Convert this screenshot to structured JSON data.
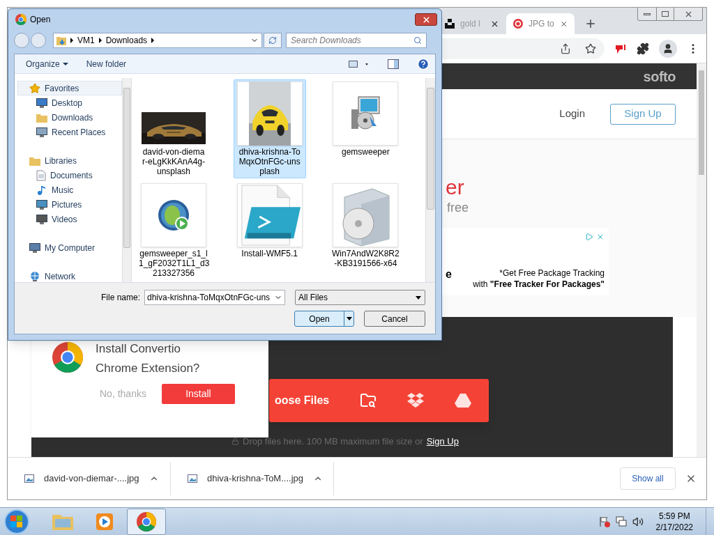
{
  "browser": {
    "tabs": [
      {
        "label": "gold l",
        "selected": false
      },
      {
        "label": "JPG to",
        "selected": true
      }
    ],
    "page": {
      "logo": "softo",
      "login": "Login",
      "signup": "Sign Up",
      "heading": "er",
      "subheading": "free",
      "ad": {
        "side_text": "e",
        "lines": [
          "*Get Free Package Tracking",
          "with **\"Free Tracker For Packages\"**"
        ]
      },
      "upload": {
        "button": "oose Files",
        "note": "Drop files here. 100 MB maximum file size or",
        "link": "Sign Up"
      },
      "popup": {
        "title_lines": [
          "Install Convertio",
          "Chrome Extension?"
        ],
        "dismiss": "No, thanks",
        "install": "Install"
      }
    },
    "downloads": {
      "items": [
        "david-von-diemar-....jpg",
        "dhiva-krishna-ToM....jpg"
      ],
      "show_all": "Show all"
    }
  },
  "dialog": {
    "title": "Open",
    "breadcrumb": [
      "VM1",
      "Downloads"
    ],
    "search": {
      "placeholder": "Search Downloads"
    },
    "toolbar": [
      "Organize",
      "New folder"
    ],
    "nav": [
      {
        "label": "Favorites",
        "kind": "star",
        "selected": true,
        "children": [
          {
            "label": "Desktop",
            "kind": "desktop",
            "selected": false
          },
          {
            "label": "Downloads",
            "kind": "folder",
            "selected": false
          },
          {
            "label": "Recent Places",
            "kind": "recent",
            "selected": false
          }
        ]
      },
      {
        "label": "Libraries",
        "kind": "library",
        "selected": false,
        "children": [
          {
            "label": "Documents",
            "kind": "document",
            "selected": false
          },
          {
            "label": "Music",
            "kind": "music",
            "selected": false
          },
          {
            "label": "Pictures",
            "kind": "picture",
            "selected": false
          },
          {
            "label": "Videos",
            "kind": "video",
            "selected": false
          }
        ]
      },
      {
        "label": "My Computer",
        "kind": "computer",
        "selected": false
      },
      {
        "label": "Network",
        "kind": "network",
        "selected": false
      }
    ],
    "files": [
      {
        "name": "david-von-diema r-eLgKkKAnA4g- unsplash",
        "kind": "photo-dark",
        "selected": false
      },
      {
        "name": "dhiva-krishna-To MqxOtnFGc-uns plash",
        "kind": "photo-yellow",
        "selected": true
      },
      {
        "name": "gemsweeper",
        "kind": "installer",
        "selected": false
      },
      {
        "name": "gemsweeper_s1_l 1_gF2032T1L1_d3 213327356",
        "kind": "app",
        "selected": false
      },
      {
        "name": "Install-WMF5.1",
        "kind": "script",
        "selected": false
      },
      {
        "name": "Win7AndW2K8R2 -KB3191566-x64",
        "kind": "package",
        "selected": false
      }
    ],
    "file_name_label": "File name:",
    "file_name": "dhiva-krishna-ToMqxOtnFGc-uns",
    "filter": "All Files",
    "open": "Open",
    "cancel": "Cancel"
  },
  "taskbar": {
    "time": "5:59 PM",
    "date": "2/17/2022"
  }
}
